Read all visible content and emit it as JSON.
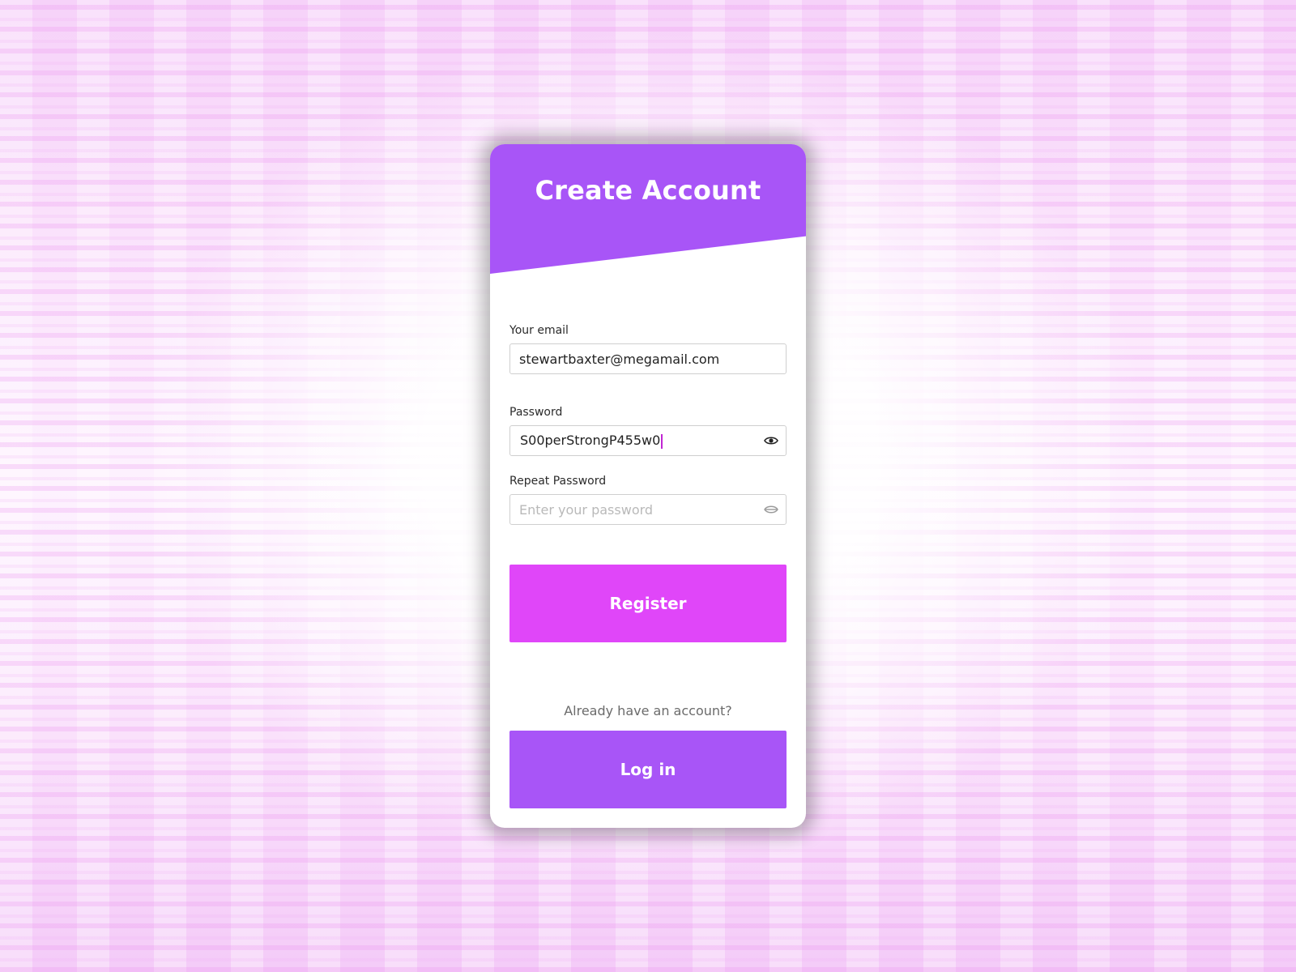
{
  "header": {
    "title": "Create Account"
  },
  "form": {
    "email": {
      "label": "Your email",
      "value": "stewartbaxter@megamail.com"
    },
    "password": {
      "label": "Password",
      "value": "S00perStrongP455w0"
    },
    "repeat_password": {
      "label": "Repeat Password",
      "value": "",
      "placeholder": "Enter your password"
    }
  },
  "actions": {
    "register_label": "Register",
    "already_text": "Already have an account?",
    "login_label": "Log in"
  },
  "icons": {
    "password_toggle": "eye-icon",
    "repeat_password_toggle": "eye-closed-icon"
  },
  "colors": {
    "header": "#a855f7",
    "register_button": "#e046f9",
    "login_button": "#a855f7",
    "cursor": "#c026d3"
  }
}
